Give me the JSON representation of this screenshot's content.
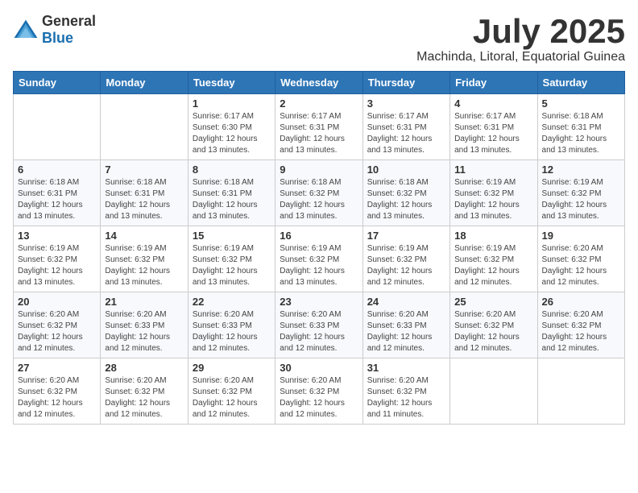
{
  "logo": {
    "general": "General",
    "blue": "Blue"
  },
  "title": "July 2025",
  "subtitle": "Machinda, Litoral, Equatorial Guinea",
  "days_of_week": [
    "Sunday",
    "Monday",
    "Tuesday",
    "Wednesday",
    "Thursday",
    "Friday",
    "Saturday"
  ],
  "weeks": [
    [
      {
        "day": "",
        "detail": ""
      },
      {
        "day": "",
        "detail": ""
      },
      {
        "day": "1",
        "detail": "Sunrise: 6:17 AM\nSunset: 6:30 PM\nDaylight: 12 hours\nand 13 minutes."
      },
      {
        "day": "2",
        "detail": "Sunrise: 6:17 AM\nSunset: 6:31 PM\nDaylight: 12 hours\nand 13 minutes."
      },
      {
        "day": "3",
        "detail": "Sunrise: 6:17 AM\nSunset: 6:31 PM\nDaylight: 12 hours\nand 13 minutes."
      },
      {
        "day": "4",
        "detail": "Sunrise: 6:17 AM\nSunset: 6:31 PM\nDaylight: 12 hours\nand 13 minutes."
      },
      {
        "day": "5",
        "detail": "Sunrise: 6:18 AM\nSunset: 6:31 PM\nDaylight: 12 hours\nand 13 minutes."
      }
    ],
    [
      {
        "day": "6",
        "detail": "Sunrise: 6:18 AM\nSunset: 6:31 PM\nDaylight: 12 hours\nand 13 minutes."
      },
      {
        "day": "7",
        "detail": "Sunrise: 6:18 AM\nSunset: 6:31 PM\nDaylight: 12 hours\nand 13 minutes."
      },
      {
        "day": "8",
        "detail": "Sunrise: 6:18 AM\nSunset: 6:31 PM\nDaylight: 12 hours\nand 13 minutes."
      },
      {
        "day": "9",
        "detail": "Sunrise: 6:18 AM\nSunset: 6:32 PM\nDaylight: 12 hours\nand 13 minutes."
      },
      {
        "day": "10",
        "detail": "Sunrise: 6:18 AM\nSunset: 6:32 PM\nDaylight: 12 hours\nand 13 minutes."
      },
      {
        "day": "11",
        "detail": "Sunrise: 6:19 AM\nSunset: 6:32 PM\nDaylight: 12 hours\nand 13 minutes."
      },
      {
        "day": "12",
        "detail": "Sunrise: 6:19 AM\nSunset: 6:32 PM\nDaylight: 12 hours\nand 13 minutes."
      }
    ],
    [
      {
        "day": "13",
        "detail": "Sunrise: 6:19 AM\nSunset: 6:32 PM\nDaylight: 12 hours\nand 13 minutes."
      },
      {
        "day": "14",
        "detail": "Sunrise: 6:19 AM\nSunset: 6:32 PM\nDaylight: 12 hours\nand 13 minutes."
      },
      {
        "day": "15",
        "detail": "Sunrise: 6:19 AM\nSunset: 6:32 PM\nDaylight: 12 hours\nand 13 minutes."
      },
      {
        "day": "16",
        "detail": "Sunrise: 6:19 AM\nSunset: 6:32 PM\nDaylight: 12 hours\nand 13 minutes."
      },
      {
        "day": "17",
        "detail": "Sunrise: 6:19 AM\nSunset: 6:32 PM\nDaylight: 12 hours\nand 12 minutes."
      },
      {
        "day": "18",
        "detail": "Sunrise: 6:19 AM\nSunset: 6:32 PM\nDaylight: 12 hours\nand 12 minutes."
      },
      {
        "day": "19",
        "detail": "Sunrise: 6:20 AM\nSunset: 6:32 PM\nDaylight: 12 hours\nand 12 minutes."
      }
    ],
    [
      {
        "day": "20",
        "detail": "Sunrise: 6:20 AM\nSunset: 6:32 PM\nDaylight: 12 hours\nand 12 minutes."
      },
      {
        "day": "21",
        "detail": "Sunrise: 6:20 AM\nSunset: 6:33 PM\nDaylight: 12 hours\nand 12 minutes."
      },
      {
        "day": "22",
        "detail": "Sunrise: 6:20 AM\nSunset: 6:33 PM\nDaylight: 12 hours\nand 12 minutes."
      },
      {
        "day": "23",
        "detail": "Sunrise: 6:20 AM\nSunset: 6:33 PM\nDaylight: 12 hours\nand 12 minutes."
      },
      {
        "day": "24",
        "detail": "Sunrise: 6:20 AM\nSunset: 6:33 PM\nDaylight: 12 hours\nand 12 minutes."
      },
      {
        "day": "25",
        "detail": "Sunrise: 6:20 AM\nSunset: 6:32 PM\nDaylight: 12 hours\nand 12 minutes."
      },
      {
        "day": "26",
        "detail": "Sunrise: 6:20 AM\nSunset: 6:32 PM\nDaylight: 12 hours\nand 12 minutes."
      }
    ],
    [
      {
        "day": "27",
        "detail": "Sunrise: 6:20 AM\nSunset: 6:32 PM\nDaylight: 12 hours\nand 12 minutes."
      },
      {
        "day": "28",
        "detail": "Sunrise: 6:20 AM\nSunset: 6:32 PM\nDaylight: 12 hours\nand 12 minutes."
      },
      {
        "day": "29",
        "detail": "Sunrise: 6:20 AM\nSunset: 6:32 PM\nDaylight: 12 hours\nand 12 minutes."
      },
      {
        "day": "30",
        "detail": "Sunrise: 6:20 AM\nSunset: 6:32 PM\nDaylight: 12 hours\nand 12 minutes."
      },
      {
        "day": "31",
        "detail": "Sunrise: 6:20 AM\nSunset: 6:32 PM\nDaylight: 12 hours\nand 11 minutes."
      },
      {
        "day": "",
        "detail": ""
      },
      {
        "day": "",
        "detail": ""
      }
    ]
  ]
}
